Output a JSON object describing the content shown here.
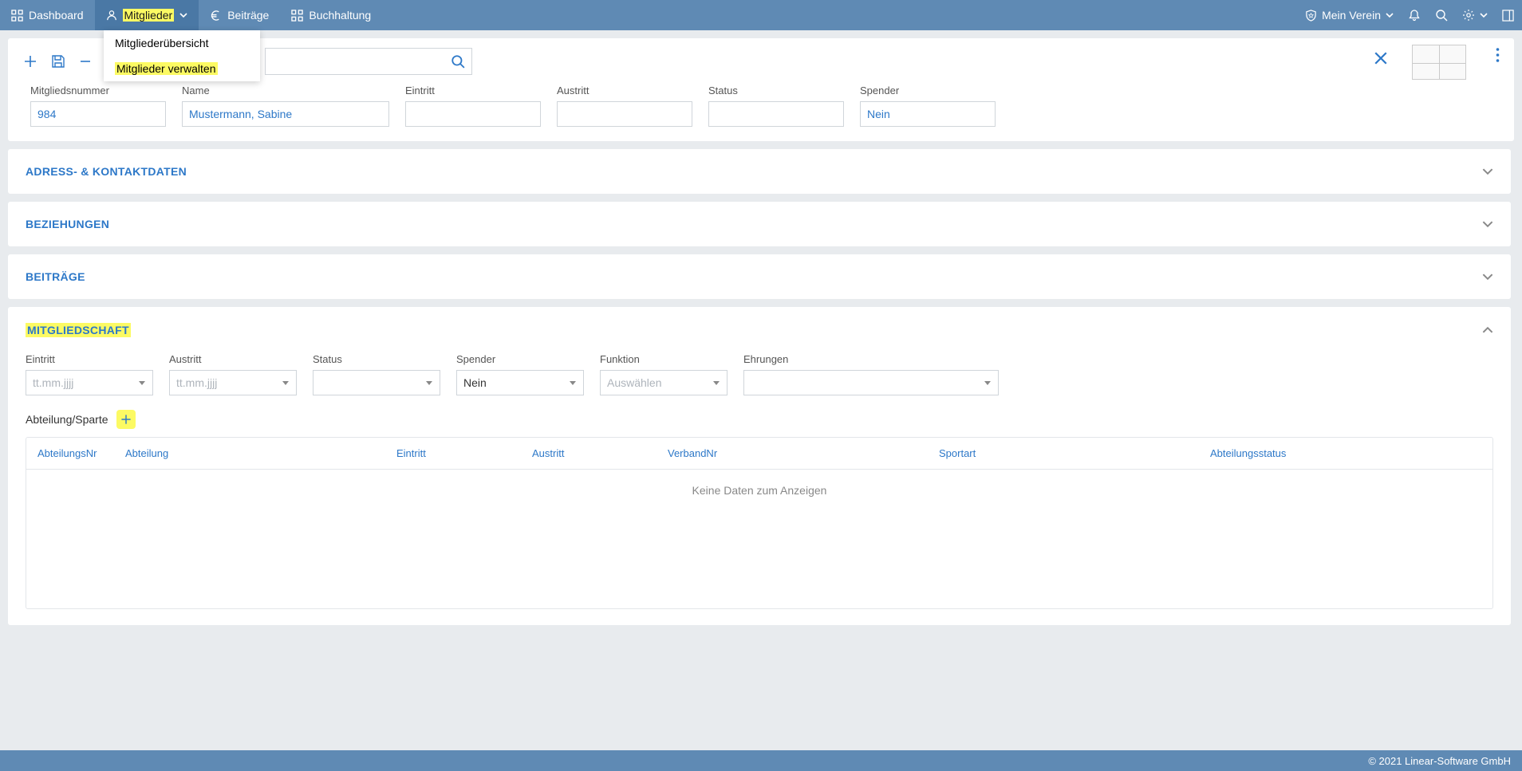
{
  "nav": {
    "dashboard": "Dashboard",
    "mitglieder": "Mitglieder",
    "beitraege": "Beiträge",
    "buchhaltung": "Buchhaltung",
    "verein": "Mein Verein"
  },
  "dropdown": {
    "item1": "Mitgliederübersicht",
    "item2": "Mitglieder verwalten"
  },
  "topFields": {
    "mitgliedsnummer_label": "Mitgliedsnummer",
    "mitgliedsnummer_value": "984",
    "name_label": "Name",
    "name_value": "Mustermann, Sabine",
    "eintritt_label": "Eintritt",
    "eintritt_value": "",
    "austritt_label": "Austritt",
    "austritt_value": "",
    "status_label": "Status",
    "status_value": "",
    "spender_label": "Spender",
    "spender_value": "Nein"
  },
  "panels": {
    "adress": "ADRESS- & KONTAKTDATEN",
    "beziehungen": "BEZIEHUNGEN",
    "beitraege": "BEITRÄGE",
    "mitgliedschaft": "MITGLIEDSCHAFT"
  },
  "membership": {
    "eintritt_label": "Eintritt",
    "eintritt_ph": "tt.mm.jjjj",
    "austritt_label": "Austritt",
    "austritt_ph": "tt.mm.jjjj",
    "status_label": "Status",
    "spender_label": "Spender",
    "spender_value": "Nein",
    "funktion_label": "Funktion",
    "funktion_ph": "Auswählen",
    "ehrungen_label": "Ehrungen",
    "abteilung_label": "Abteilung/Sparte"
  },
  "table": {
    "col0": "AbteilungsNr",
    "col1": "Abteilung",
    "col2": "Eintritt",
    "col3": "Austritt",
    "col4": "VerbandNr",
    "col5": "Sportart",
    "col6": "Abteilungsstatus",
    "nodata": "Keine Daten zum Anzeigen"
  },
  "footer": "© 2021 Linear-Software GmbH"
}
